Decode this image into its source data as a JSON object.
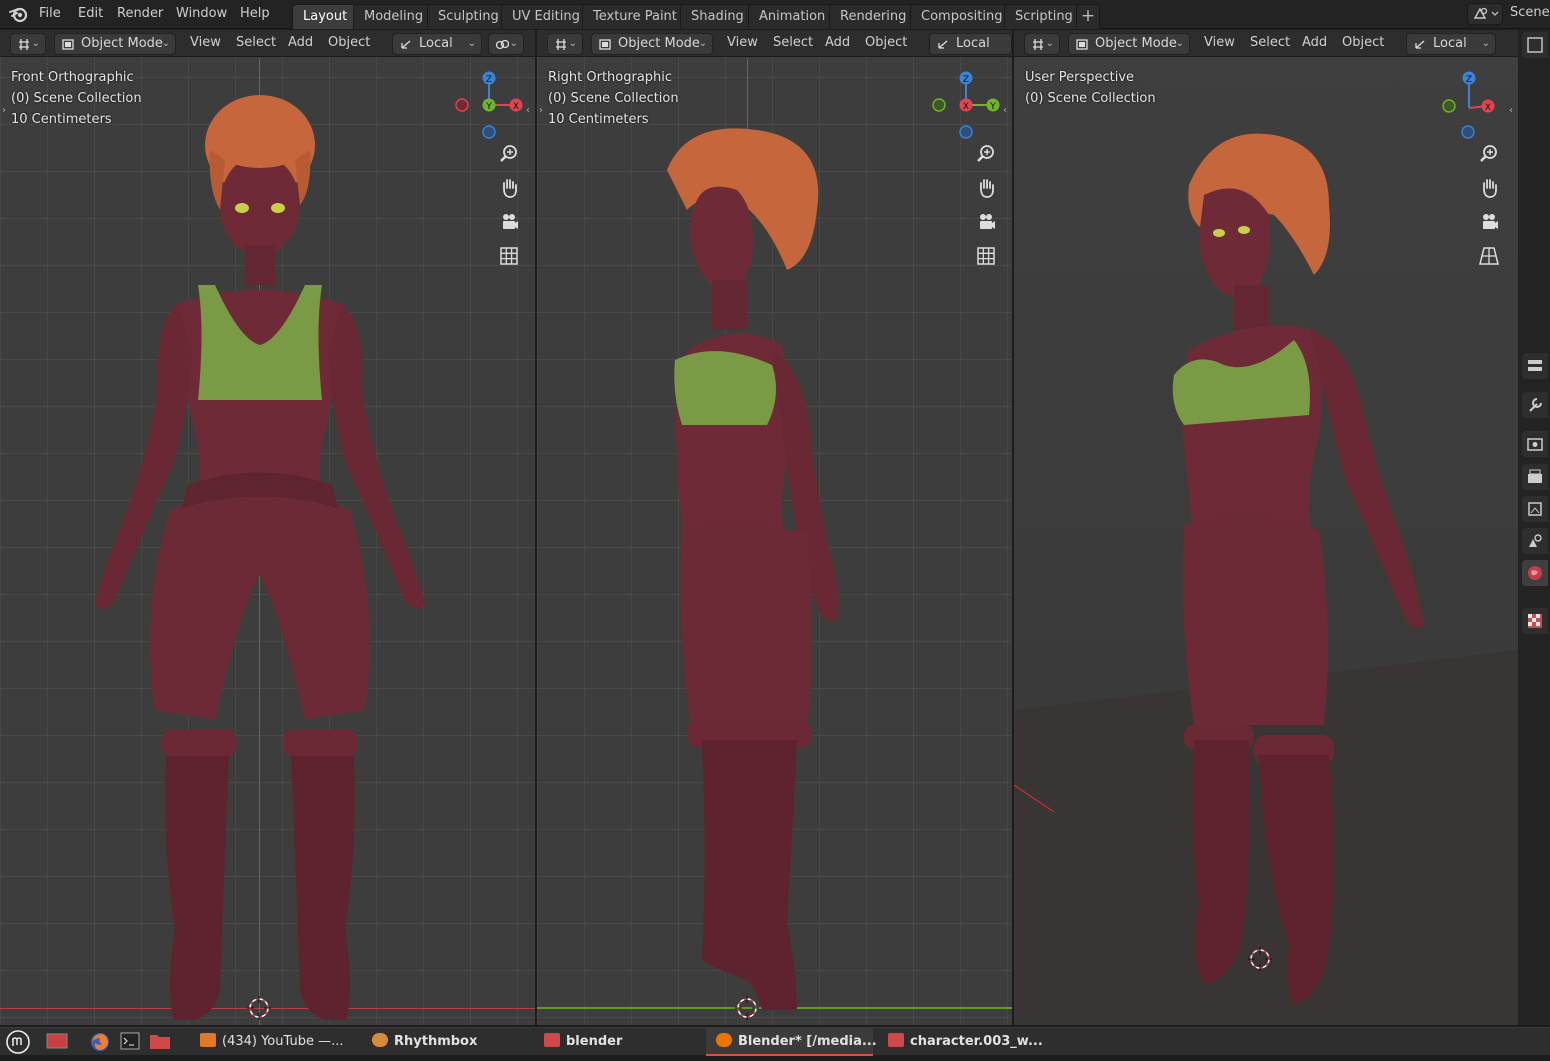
{
  "app": {
    "menu": [
      "File",
      "Edit",
      "Render",
      "Window",
      "Help"
    ],
    "workspace_tabs": [
      "Layout",
      "Modeling",
      "Sculpting",
      "UV Editing",
      "Texture Paint",
      "Shading",
      "Animation",
      "Rendering",
      "Compositing",
      "Scripting"
    ],
    "active_tab": "Layout",
    "add_tab": "+",
    "scene_label": "Scene"
  },
  "viewports": [
    {
      "mode": "Object Mode",
      "menus": [
        "View",
        "Select",
        "Add",
        "Object"
      ],
      "pivot": "Local",
      "view_name": "Front Orthographic",
      "collection": "(0) Scene Collection",
      "scale": "10 Centimeters",
      "gizmo_axes": [
        "Z",
        "Y",
        "X"
      ]
    },
    {
      "mode": "Object Mode",
      "menus": [
        "View",
        "Select",
        "Add",
        "Object"
      ],
      "pivot": "Local",
      "view_name": "Right Orthographic",
      "collection": "(0) Scene Collection",
      "scale": "10 Centimeters",
      "gizmo_axes": [
        "Z",
        "X",
        "Y"
      ]
    },
    {
      "mode": "Object Mode",
      "menus": [
        "View",
        "Select",
        "Add",
        "Object"
      ],
      "pivot": "Local",
      "view_name": "User Perspective",
      "collection": "(0) Scene Collection",
      "gizmo_axes": [
        "Z",
        "X"
      ]
    }
  ],
  "nav_icons": [
    "zoom-icon",
    "pan-hand-icon",
    "camera-icon",
    "grid-ortho-icon"
  ],
  "colors": {
    "skin": "#6e2b37",
    "top": "#7a9a45",
    "hair": "#c5663c",
    "eyes": "#c8d04a",
    "axis_x": "#e2434f",
    "axis_y": "#70b42a",
    "axis_z": "#3a83d6"
  },
  "taskbar": {
    "items": [
      {
        "label": "",
        "icon": "mint-menu-icon"
      },
      {
        "label": "",
        "icon": "show-desktop-icon"
      },
      {
        "label": "",
        "icon": "firefox-icon"
      },
      {
        "label": "",
        "icon": "terminal-icon"
      },
      {
        "label": "",
        "icon": "folder-icon"
      },
      {
        "label": "(434) YouTube —...",
        "icon": "firefox-icon"
      },
      {
        "label": "Rhythmbox",
        "icon": "rhythmbox-icon"
      },
      {
        "label": "blender",
        "icon": "folder-icon"
      },
      {
        "label": "Blender* [/media...",
        "icon": "blender-icon"
      },
      {
        "label": "character.003_w...",
        "icon": "folder-icon"
      }
    ]
  }
}
